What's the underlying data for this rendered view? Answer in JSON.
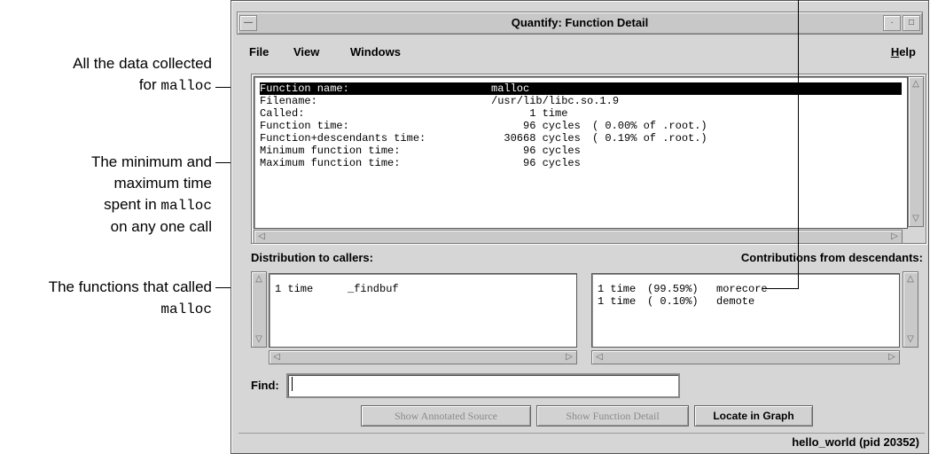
{
  "annotations": {
    "a1_line1": "All the data collected",
    "a1_line2_prefix": "for",
    "a1_line2_code": "malloc",
    "a2_line1": "The minimum and",
    "a2_line2": "maximum time",
    "a2_line3_prefix": "spent in",
    "a2_line3_code": "malloc",
    "a2_line4": "on any one call",
    "a3_line1": "The functions that called",
    "a3_line2_code": "malloc"
  },
  "window": {
    "title": "Quantify: Function Detail",
    "minimize_glyph": "·",
    "maximize_glyph": "□",
    "menu_glyph": "—"
  },
  "menu": {
    "file": "File",
    "view": "View",
    "windows": "Windows",
    "help_first": "H",
    "help_rest": "elp"
  },
  "details": {
    "rows": [
      {
        "label": "Function name:",
        "value": "malloc",
        "extra": ""
      },
      {
        "label": "Filename:",
        "value": "/usr/lib/libc.so.1.9",
        "extra": ""
      },
      {
        "label": "Called:",
        "value": "      1 time",
        "extra": ""
      },
      {
        "label": "Function time:",
        "value": "     96 cycles",
        "extra": "( 0.00% of .root.)"
      },
      {
        "label": "Function+descendants time:",
        "value": "  30668 cycles",
        "extra": "( 0.19% of .root.)"
      },
      {
        "label": "Minimum function time:",
        "value": "     96 cycles",
        "extra": ""
      },
      {
        "label": "Maximum function time:",
        "value": "     96 cycles",
        "extra": ""
      }
    ]
  },
  "callers": {
    "heading": "Distribution to callers:",
    "rows": [
      {
        "count": "1 time",
        "pct": "",
        "name": "_findbuf"
      }
    ]
  },
  "descendants": {
    "heading": "Contributions from descendants:",
    "rows": [
      {
        "count": "1 time",
        "pct": "(99.59%)",
        "name": "morecore"
      },
      {
        "count": "1 time",
        "pct": "( 0.10%)",
        "name": "demote"
      }
    ]
  },
  "find": {
    "label": "Find:",
    "value": ""
  },
  "buttons": {
    "show_source": "Show Annotated Source",
    "show_detail": "Show Function Detail",
    "locate": "Locate in Graph"
  },
  "status": {
    "text": "hello_world (pid 20352)"
  },
  "icons": {
    "arrow_up": "△",
    "arrow_down": "▽",
    "arrow_left": "◁",
    "arrow_right": "▷"
  }
}
